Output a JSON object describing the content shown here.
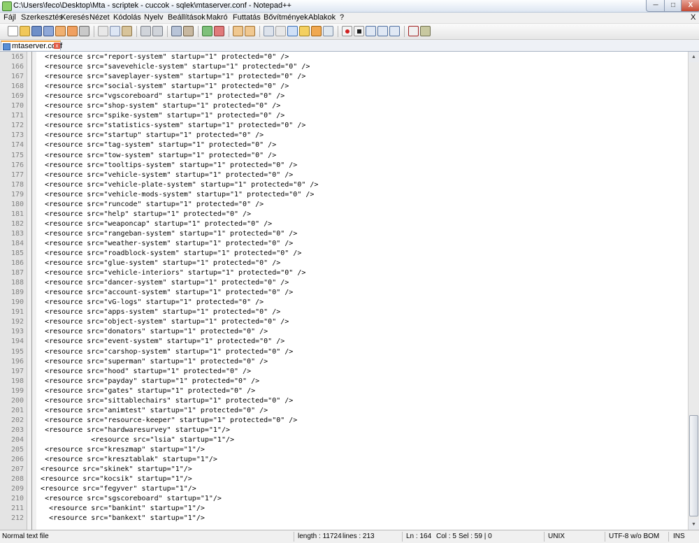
{
  "window": {
    "title": "C:\\Users\\feco\\Desktop\\Mta - scriptek - cuccok - sqlek\\mtaserver.conf - Notepad++",
    "min_label": "─",
    "max_label": "□",
    "close_label": "X"
  },
  "menu": {
    "items": [
      "Fájl",
      "Szerkesztés",
      "Keresés",
      "Nézet",
      "Kódolás",
      "Nyelv",
      "Beállítások",
      "Makró",
      "Futtatás",
      "Bővítmények",
      "Ablakok",
      "?"
    ],
    "close_x": "X"
  },
  "toolbar": {
    "icons": [
      "new-file-icon",
      "open-file-icon",
      "save-icon",
      "save-all-icon",
      "close-icon",
      "close-all-icon",
      "print-icon",
      "cut-icon",
      "copy-icon",
      "paste-icon",
      "undo-icon",
      "redo-icon",
      "find-icon",
      "replace-icon",
      "zoom-in-icon",
      "zoom-out-icon",
      "sync-v-icon",
      "sync-h-icon",
      "word-wrap-icon",
      "show-all-chars-icon",
      "indent-guide-icon",
      "udl-icon",
      "doc-map-icon",
      "function-list-icon",
      "record-macro-icon",
      "stop-macro-icon",
      "play-macro-icon",
      "play-multi-macro-icon",
      "save-macro-icon",
      "spellcheck-icon",
      "plugin-icon"
    ]
  },
  "tab": {
    "label": "mtaserver.conf",
    "close": "x"
  },
  "editor": {
    "lines": [
      {
        "n": "165",
        "t": "    <resource src=\"report-system\" startup=\"1\" protected=\"0\" />"
      },
      {
        "n": "166",
        "t": "    <resource src=\"savevehicle-system\" startup=\"1\" protected=\"0\" />"
      },
      {
        "n": "167",
        "t": "    <resource src=\"saveplayer-system\" startup=\"1\" protected=\"0\" />"
      },
      {
        "n": "168",
        "t": "    <resource src=\"social-system\" startup=\"1\" protected=\"0\" />"
      },
      {
        "n": "169",
        "t": "    <resource src=\"vgscoreboard\" startup=\"1\" protected=\"0\" />"
      },
      {
        "n": "170",
        "t": "    <resource src=\"shop-system\" startup=\"1\" protected=\"0\" />"
      },
      {
        "n": "171",
        "t": "    <resource src=\"spike-system\" startup=\"1\" protected=\"0\" />"
      },
      {
        "n": "172",
        "t": "    <resource src=\"statistics-system\" startup=\"1\" protected=\"0\" />"
      },
      {
        "n": "173",
        "t": "    <resource src=\"startup\" startup=\"1\" protected=\"0\" />"
      },
      {
        "n": "174",
        "t": "    <resource src=\"tag-system\" startup=\"1\" protected=\"0\" />"
      },
      {
        "n": "175",
        "t": "    <resource src=\"tow-system\" startup=\"1\" protected=\"0\" />"
      },
      {
        "n": "176",
        "t": "    <resource src=\"tooltips-system\" startup=\"1\" protected=\"0\" />"
      },
      {
        "n": "177",
        "t": "    <resource src=\"vehicle-system\" startup=\"1\" protected=\"0\" />"
      },
      {
        "n": "178",
        "t": "    <resource src=\"vehicle-plate-system\" startup=\"1\" protected=\"0\" />"
      },
      {
        "n": "179",
        "t": "    <resource src=\"vehicle-mods-system\" startup=\"1\" protected=\"0\" />"
      },
      {
        "n": "180",
        "t": "    <resource src=\"runcode\" startup=\"1\" protected=\"0\" />"
      },
      {
        "n": "181",
        "t": "    <resource src=\"help\" startup=\"1\" protected=\"0\" />"
      },
      {
        "n": "182",
        "t": "    <resource src=\"weaponcap\" startup=\"1\" protected=\"0\" />"
      },
      {
        "n": "183",
        "t": "    <resource src=\"rangeban-system\" startup=\"1\" protected=\"0\" />"
      },
      {
        "n": "184",
        "t": "    <resource src=\"weather-system\" startup=\"1\" protected=\"0\" />"
      },
      {
        "n": "185",
        "t": "    <resource src=\"roadblock-system\" startup=\"1\" protected=\"0\" />"
      },
      {
        "n": "186",
        "t": "    <resource src=\"glue-system\" startup=\"1\" protected=\"0\" />"
      },
      {
        "n": "187",
        "t": "    <resource src=\"vehicle-interiors\" startup=\"1\" protected=\"0\" />"
      },
      {
        "n": "188",
        "t": "    <resource src=\"dancer-system\" startup=\"1\" protected=\"0\" />"
      },
      {
        "n": "189",
        "t": "    <resource src=\"account-system\" startup=\"1\" protected=\"0\" />"
      },
      {
        "n": "190",
        "t": "    <resource src=\"vG-logs\" startup=\"1\" protected=\"0\" />"
      },
      {
        "n": "191",
        "t": "    <resource src=\"apps-system\" startup=\"1\" protected=\"0\" />"
      },
      {
        "n": "192",
        "t": "    <resource src=\"object-system\" startup=\"1\" protected=\"0\" />"
      },
      {
        "n": "193",
        "t": "    <resource src=\"donators\" startup=\"1\" protected=\"0\" />"
      },
      {
        "n": "194",
        "t": "    <resource src=\"event-system\" startup=\"1\" protected=\"0\" />"
      },
      {
        "n": "195",
        "t": "    <resource src=\"carshop-system\" startup=\"1\" protected=\"0\" />"
      },
      {
        "n": "196",
        "t": "    <resource src=\"superman\" startup=\"1\" protected=\"0\" />"
      },
      {
        "n": "197",
        "t": "    <resource src=\"hood\" startup=\"1\" protected=\"0\" />"
      },
      {
        "n": "198",
        "t": "    <resource src=\"payday\" startup=\"1\" protected=\"0\" />"
      },
      {
        "n": "199",
        "t": "    <resource src=\"gates\" startup=\"1\" protected=\"0\" />"
      },
      {
        "n": "200",
        "t": "    <resource src=\"sittablechairs\" startup=\"1\" protected=\"0\" />"
      },
      {
        "n": "201",
        "t": "    <resource src=\"animtest\" startup=\"1\" protected=\"0\" />"
      },
      {
        "n": "202",
        "t": "    <resource src=\"resource-keeper\" startup=\"1\" protected=\"0\" />"
      },
      {
        "n": "203",
        "t": "    <resource src=\"hardwaresurvey\" startup=\"1\"/>"
      },
      {
        "n": "204",
        "t": "               <resource src=\"lsia\" startup=\"1\"/>"
      },
      {
        "n": "205",
        "t": "    <resource src=\"kreszmap\" startup=\"1\"/>"
      },
      {
        "n": "206",
        "t": "    <resource src=\"kresztablak\" startup=\"1\"/>"
      },
      {
        "n": "207",
        "t": "   <resource src=\"skinek\" startup=\"1\"/>"
      },
      {
        "n": "208",
        "t": "   <resource src=\"kocsik\" startup=\"1\"/>"
      },
      {
        "n": "209",
        "t": "   <resource src=\"fegyver\" startup=\"1\"/>"
      },
      {
        "n": "210",
        "t": "    <resource src=\"sgscoreboard\" startup=\"1\"/>"
      },
      {
        "n": "211",
        "t": "     <resource src=\"bankint\" startup=\"1\"/>"
      },
      {
        "n": "212",
        "t": "     <resource src=\"bankext\" startup=\"1\"/>"
      }
    ]
  },
  "status": {
    "file_type": "Normal text file",
    "length": "length : 11724",
    "lines": "lines : 213",
    "ln": "Ln : 164",
    "col": "Col : 5",
    "sel": "Sel : 59 | 0",
    "eol": "UNIX",
    "encoding": "UTF-8 w/o BOM",
    "mode": "INS"
  },
  "colors": {
    "tab_accent": "#f6a53c",
    "close_red": "#c44a33",
    "gutter": "#e4e4e4"
  }
}
